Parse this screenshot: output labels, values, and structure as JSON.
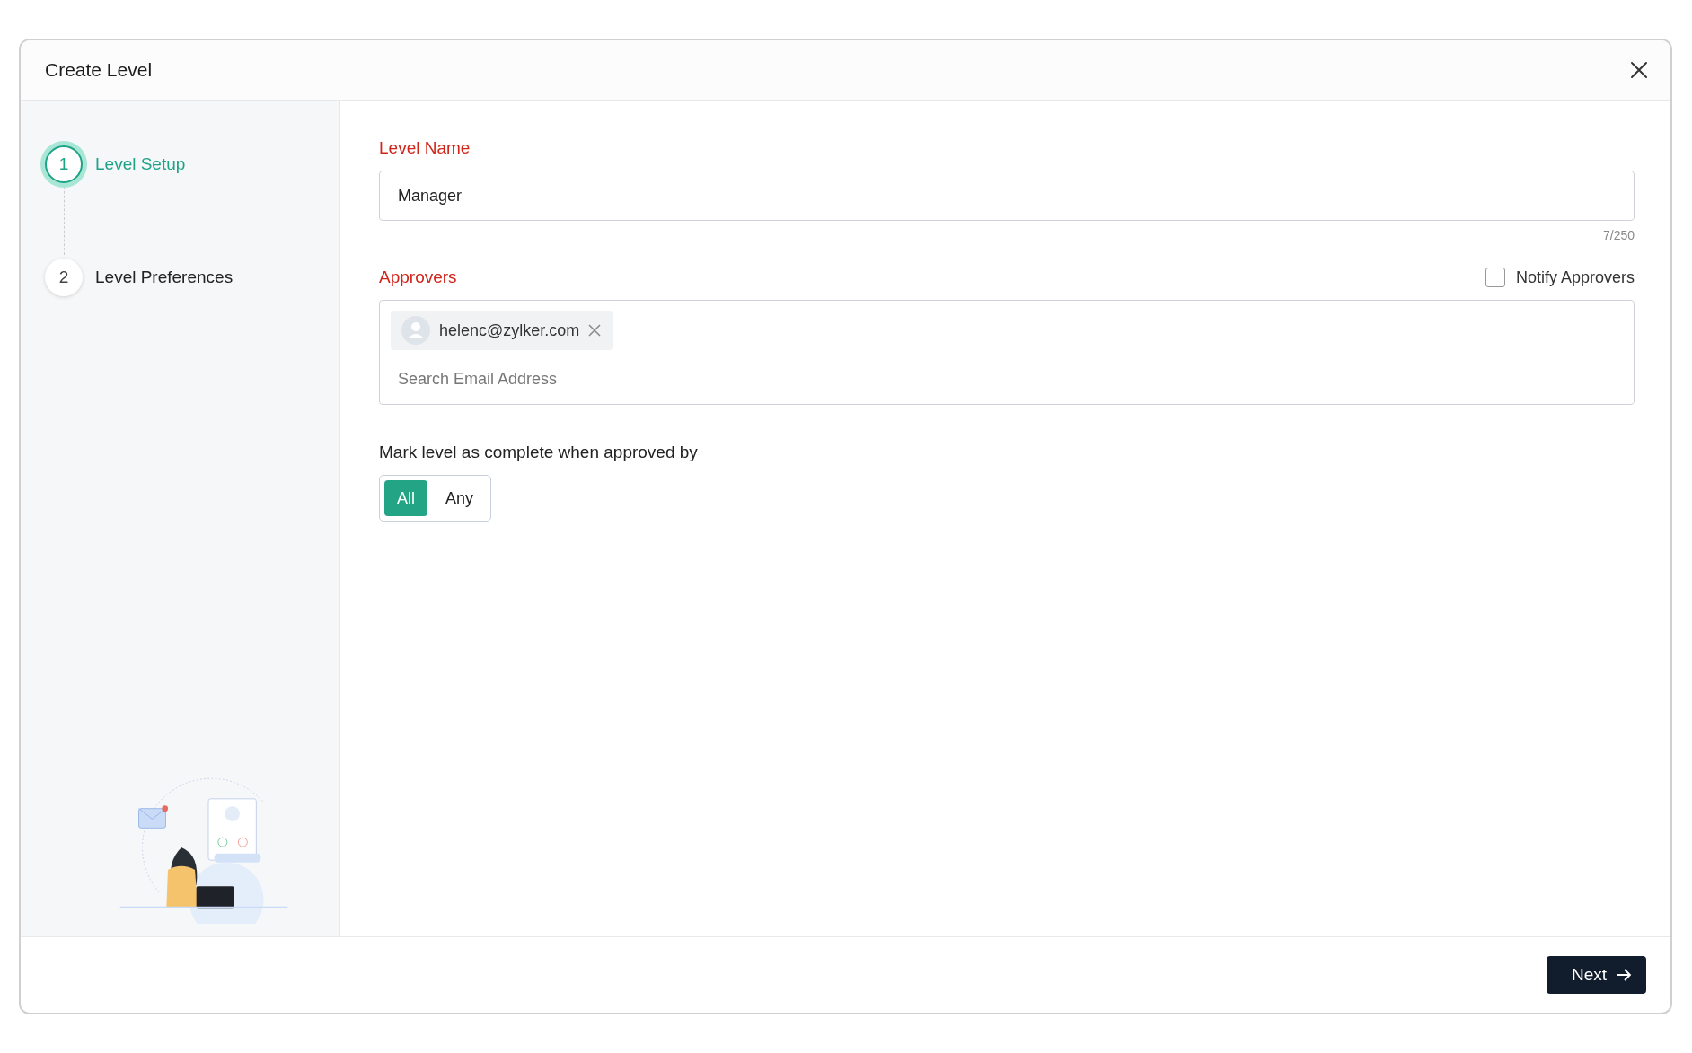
{
  "dialog": {
    "title": "Create Level"
  },
  "steps": [
    {
      "number": "1",
      "label": "Level Setup",
      "selected": true
    },
    {
      "number": "2",
      "label": "Level Preferences",
      "selected": false
    }
  ],
  "form": {
    "level_name": {
      "label": "Level Name",
      "value": "Manager",
      "counter": "7/250"
    },
    "approvers": {
      "label": "Approvers",
      "notify": {
        "label": "Notify Approvers",
        "checked": false
      },
      "chips": [
        {
          "email": "helenc@zylker.com"
        }
      ],
      "placeholder": "Search Email Address"
    },
    "completion": {
      "label": "Mark level as complete when approved by",
      "options": [
        {
          "label": "All",
          "selected": true
        },
        {
          "label": "Any",
          "selected": false
        }
      ]
    }
  },
  "footer": {
    "next_button": "Next"
  }
}
